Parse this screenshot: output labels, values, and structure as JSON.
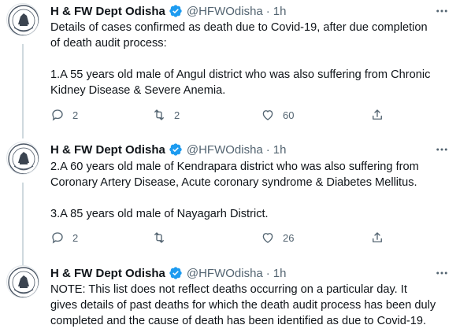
{
  "tweets": [
    {
      "name": "H & FW Dept Odisha",
      "handle": "@HFWOdisha",
      "separator": "·",
      "time": "1h",
      "paragraphs": [
        "Details of cases confirmed as death due to Covid-19, after due completion\nof death audit process:",
        "1.A 55 years old male of Angul district who was also suffering from Chronic\nKidney Disease & Severe Anemia."
      ],
      "replies": "2",
      "retweets": "2",
      "likes": "60"
    },
    {
      "name": "H & FW Dept Odisha",
      "handle": "@HFWOdisha",
      "separator": "·",
      "time": "1h",
      "paragraphs": [
        "2.A 60 years old male of Kendrapara district who was also suffering from\nCoronary Artery Disease, Acute coronary syndrome & Diabetes Mellitus.",
        "3.A 85 years old male of Nayagarh District."
      ],
      "replies": "2",
      "retweets": "",
      "likes": "26"
    },
    {
      "name": "H & FW Dept Odisha",
      "handle": "@HFWOdisha",
      "separator": "·",
      "time": "1h",
      "paragraphs": [
        "NOTE: This list does not reflect deaths occurring on a particular day. It\ngives details of past deaths for which the death audit process has been duly\ncompleted and the cause of death has been identified as due to Covid-19."
      ]
    }
  ],
  "icons": {
    "avatar": "odisha-emblem-icon",
    "verified": "verified-badge-icon",
    "more": "more-options-icon",
    "reply": "reply-icon",
    "retweet": "retweet-icon",
    "like": "like-icon",
    "share": "share-icon"
  },
  "colors": {
    "verified": "#1d9bf0",
    "secondary_text": "#536471",
    "thread_line": "#cfd9de",
    "primary_text": "#0f1419"
  }
}
